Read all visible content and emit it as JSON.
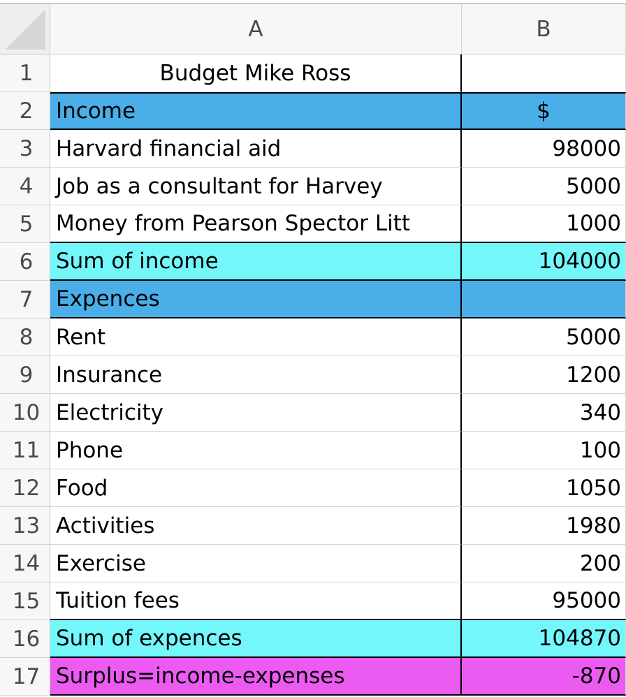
{
  "columns": [
    "A",
    "B"
  ],
  "rows": [
    {
      "num": "1",
      "a": "Budget Mike Ross",
      "b": "",
      "style": "title"
    },
    {
      "num": "2",
      "a": "Income",
      "b": "$",
      "style": "dark"
    },
    {
      "num": "3",
      "a": "Harvard financial aid",
      "b": "98000",
      "style": "white"
    },
    {
      "num": "4",
      "a": "Job as a consultant for Harvey",
      "b": "5000",
      "style": "white"
    },
    {
      "num": "5",
      "a": "Money from Pearson Spector Litt",
      "b": "1000",
      "style": "white"
    },
    {
      "num": "6",
      "a": "Sum of income",
      "b": "104000",
      "style": "cyan"
    },
    {
      "num": "7",
      "a": "Expences",
      "b": "",
      "style": "dark"
    },
    {
      "num": "8",
      "a": "Rent",
      "b": "5000",
      "style": "white"
    },
    {
      "num": "9",
      "a": "Insurance",
      "b": "1200",
      "style": "white"
    },
    {
      "num": "10",
      "a": "Electricity",
      "b": "340",
      "style": "white"
    },
    {
      "num": "11",
      "a": "Phone",
      "b": "100",
      "style": "white"
    },
    {
      "num": "12",
      "a": "Food",
      "b": "1050",
      "style": "white"
    },
    {
      "num": "13",
      "a": "Activities",
      "b": "1980",
      "style": "white"
    },
    {
      "num": "14",
      "a": "Exercise",
      "b": "200",
      "style": "white"
    },
    {
      "num": "15",
      "a": "Tuition fees",
      "b": "95000",
      "style": "white"
    },
    {
      "num": "16",
      "a": "Sum of expences",
      "b": "104870",
      "style": "cyan"
    },
    {
      "num": "17",
      "a": "Surplus=income-expenses",
      "b": "-870",
      "style": "pink"
    }
  ],
  "colors": {
    "header_blue": "#4aaee8",
    "sum_cyan": "#73f7fb",
    "surplus_pink": "#eb5bf2"
  }
}
